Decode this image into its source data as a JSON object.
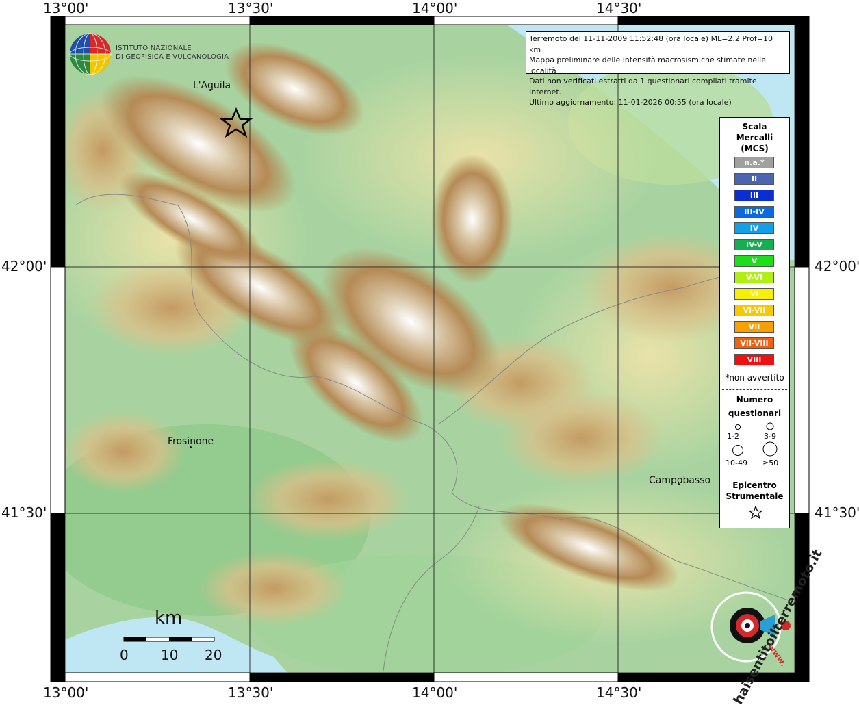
{
  "axes": {
    "top_ticks": [
      "13°00'",
      "13°30'",
      "14°00'",
      "14°30'"
    ],
    "bottom_ticks": [
      "13°00'",
      "13°30'",
      "14°00'",
      "14°30'"
    ],
    "left_ticks": [
      "42°00'",
      "41°30'"
    ],
    "right_ticks": [
      "42°00'",
      "41°30'"
    ]
  },
  "logo": {
    "line1": "ISTITUTO NAZIONALE",
    "line2": "DI GEOFISICA E VULCANOLOGIA"
  },
  "info": {
    "line1": "Terremoto del 11-11-2009 11:52:48 (ora locale) ML=2.2 Prof=10 km",
    "line2": "Mappa preliminare delle intensità macrosismiche stimate nelle località",
    "line3": "Dati non verificati estratti da 1 questionari compilati tramite Internet.",
    "line4": "Ultimo aggiornamento: 11-01-2026 00:55 (ora locale)"
  },
  "cities": [
    "L'Aquila",
    "Frosinone",
    "Campobasso"
  ],
  "legend": {
    "title1": "Scala",
    "title2": "Mercalli",
    "title3": "(MCS)",
    "scale": [
      {
        "label": "n.a.*",
        "color": "#a0a0a0"
      },
      {
        "label": "II",
        "color": "#4a66b0"
      },
      {
        "label": "III",
        "color": "#0b2ed0"
      },
      {
        "label": "III-IV",
        "color": "#0b6ae0"
      },
      {
        "label": "IV",
        "color": "#12a0e8"
      },
      {
        "label": "IV-V",
        "color": "#12b050"
      },
      {
        "label": "V",
        "color": "#1ae01a"
      },
      {
        "label": "V-VI",
        "color": "#b0f010"
      },
      {
        "label": "VI",
        "color": "#f8f000"
      },
      {
        "label": "VI-VII",
        "color": "#f8c800"
      },
      {
        "label": "VII",
        "color": "#f8a000"
      },
      {
        "label": "VII-VIII",
        "color": "#f06010"
      },
      {
        "label": "VIII",
        "color": "#f01010"
      }
    ],
    "not_felt": "*non avvertito",
    "count_title1": "Numero",
    "count_title2": "questionari",
    "count_bins": [
      "1-2",
      "3-9",
      "10-49",
      "≥50"
    ],
    "epicenter1": "Epicentro",
    "epicenter2": "Strumentale"
  },
  "scalebar": {
    "unit": "km",
    "labels": [
      "0",
      "10",
      "20"
    ]
  },
  "brand": {
    "text": "haisentitoilterremoto.it",
    "url": "www."
  }
}
